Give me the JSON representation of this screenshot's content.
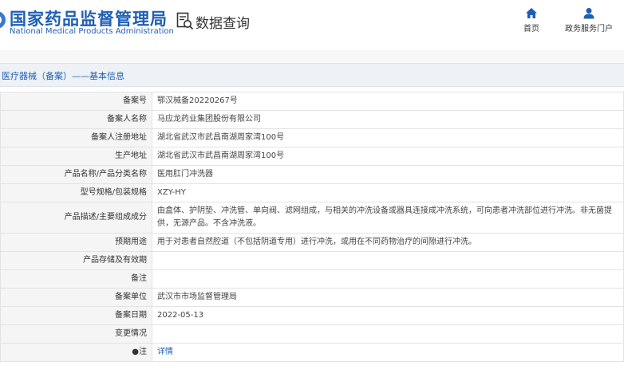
{
  "header": {
    "title_cn": "国家药品监督管理局",
    "title_en": "National Medical Products Administration",
    "query_label": "数据查询",
    "nav": {
      "home": "首页",
      "portal": "政务服务门户"
    }
  },
  "breadcrumb": "医疗器械（备案）——基本信息",
  "colors": {
    "brand": "#1f5fb3",
    "label_bg": "#f5f5f5"
  },
  "records": [
    {
      "label": "备案号",
      "value": "鄂汉械备20220267号"
    },
    {
      "label": "备案人名称",
      "value": "马应龙药业集团股份有限公司"
    },
    {
      "label": "备案人注册地址",
      "value": "湖北省武汉市武昌南湖周家湾100号"
    },
    {
      "label": "生产地址",
      "value": "湖北省武汉市武昌南湖周家湾100号"
    },
    {
      "label": "产品名称/产品分类名称",
      "value": "医用肛门冲洗器"
    },
    {
      "label": "型号规格/包装规格",
      "value": "XZY-HY"
    },
    {
      "label": "产品描述/主要组成成分",
      "value": "由盒体、护阴垫、冲洗管、单向阀、滤网组成，与相关的冲洗设备或器具连接成冲洗系统，可向患者冲洗部位进行冲洗。非无菌提供，无源产品。不含冲洗液。"
    },
    {
      "label": "预期用途",
      "value": "用于对患者自然腔道（不包括阴道专用）进行冲洗，或用在不同药物治疗的间隙进行冲洗。"
    },
    {
      "label": "产品存储及有效期",
      "value": ""
    },
    {
      "label": "备注",
      "value": ""
    },
    {
      "label": "备案单位",
      "value": "武汉市市场监督管理局"
    },
    {
      "label": "备案日期",
      "value": "2022-05-13"
    },
    {
      "label": "变更情况",
      "value": ""
    },
    {
      "label": "注",
      "value": "详情"
    }
  ]
}
